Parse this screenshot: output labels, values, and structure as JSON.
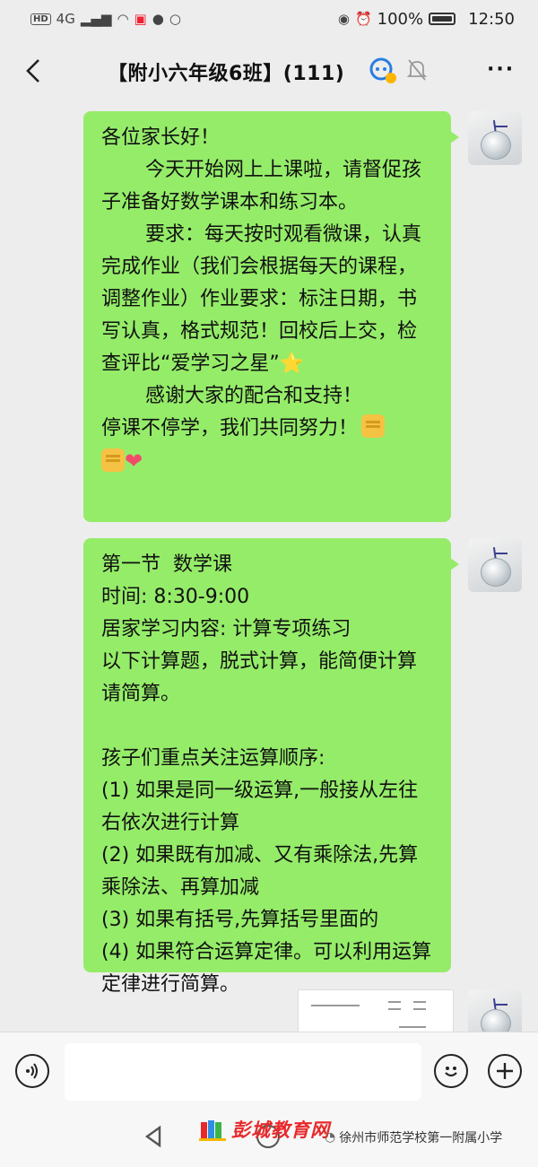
{
  "status_bar": {
    "badge": "HD",
    "network": "4G",
    "battery_percent": "100%",
    "time": "12:50"
  },
  "header": {
    "title": "【附小六年级6班】(111)"
  },
  "messages": [
    {
      "text": "各位家长好！\n       今天开始网上上课啦，请督促孩子准备好数学课本和练习本。\n       要求：每天按时观看微课，认真完成作业（我们会根据每天的课程，调整作业）作业要求：标注日期，书写认真，格式规范！回校后上交，检查评比“爱学习之星”",
      "text_after": "\n       感谢大家的配合和支持！\n停课不停学，我们共同努力！"
    },
    {
      "text": "第一节  数学课\n时间: 8:30-9:00\n居家学习内容: 计算专项练习\n以下计算题，脱式计算，能简便计算请简算。\n\n孩子们重点关注运算顺序:\n(1) 如果是同一级运算,一般接从左往右依次进行计算\n(2) 如果既有加减、又有乘除法,先算乘除法、再算加减\n(3) 如果有括号,先算括号里面的\n(4) 如果符合运算定律。可以利用运算定律进行简算。"
    }
  ],
  "input_bar": {
    "placeholder": ""
  },
  "watermark": {
    "brand": "彭城教育网",
    "account": "徐州市师范学校第一附属小学"
  },
  "icons": {
    "back": "back-arrow-icon",
    "mute": "bell-mute-icon",
    "more": "more-icon",
    "voice": "voice-icon",
    "emoji": "emoji-icon",
    "plus": "plus-icon"
  }
}
